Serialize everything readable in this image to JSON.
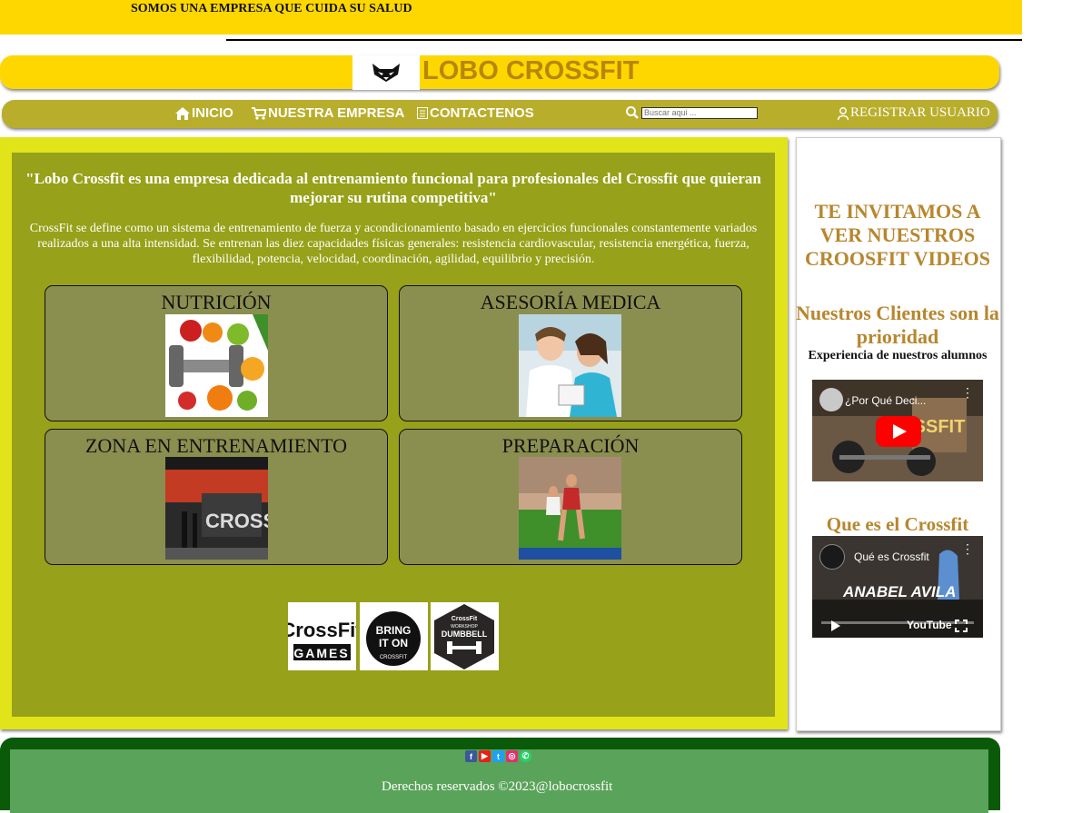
{
  "topbar": {
    "slogan": "SOMOS UNA EMPRESA QUE CUIDA SU SALUD"
  },
  "brand": {
    "title": "LOBO CROSSFIT",
    "logo_icon": "wolf-logo-icon"
  },
  "nav": {
    "items": [
      {
        "label": "INICIO",
        "icon": "home-icon"
      },
      {
        "label": "NUESTRA EMPRESA",
        "icon": "cart-icon"
      },
      {
        "label": "CONTACTENOS",
        "icon": "list-icon"
      }
    ],
    "search_placeholder": "Buscar aqui ...",
    "register_label": "REGISTRAR USUARIO"
  },
  "main": {
    "quote": "\"Lobo Crossfit es una empresa dedicada al entrenamiento funcional para profesionales del Crossfit que quieran mejorar su rutina competitiva\"",
    "description": "CrossFit se define como un sistema de entrenamiento de fuerza y acondicionamiento basado en ejercicios funcionales constantemente variados realizados a una alta intensidad. Se entrenan las diez capacidades físicas generales: resistencia cardiovascular, resistencia energética, fuerza, flexibilidad, potencia, velocidad, coordinación, agilidad, equilibrio y precisión.",
    "cards": [
      {
        "title": "NUTRICIÓN"
      },
      {
        "title": "ASESORÍA MEDICA"
      },
      {
        "title": "ZONA EN ENTRENAMIENTO"
      },
      {
        "title": "PREPARACIÓN"
      }
    ],
    "partners": [
      {
        "line1": "CrossFit",
        "line2": "GAMES"
      },
      {
        "line1": "BRING",
        "line2": "IT ON",
        "line3": "CROSSFIT"
      },
      {
        "line1": "CrossFit",
        "line2": "WORKSHOP",
        "line3": "DUMBBELL"
      }
    ]
  },
  "sidebar": {
    "heading1": "TE INVITAMOS A VER NUESTROS CROOSFIT VIDEOS",
    "heading2": "Nuestros Clientes son la prioridad",
    "subheading": "Experiencia de nuestros alumnos",
    "video1_title": "¿Por Qué Deci...",
    "heading3": "Que es el Crossfit",
    "video2_title": "Qué es Crossfit",
    "video2_overlay": "ANABEL AVILA",
    "video2_brand": "YouTube"
  },
  "footer": {
    "social": [
      {
        "icon": "facebook-icon",
        "glyph": "f",
        "color": "#3b5998"
      },
      {
        "icon": "youtube-icon",
        "glyph": "▶",
        "color": "#e62117"
      },
      {
        "icon": "twitter-icon",
        "glyph": "t",
        "color": "#1da1f2"
      },
      {
        "icon": "instagram-icon",
        "glyph": "◎",
        "color": "#e1306c"
      },
      {
        "icon": "whatsapp-icon",
        "glyph": "✆",
        "color": "#25d366"
      }
    ],
    "copyright": "Derechos reservados ©2023@lobocrossfit"
  }
}
